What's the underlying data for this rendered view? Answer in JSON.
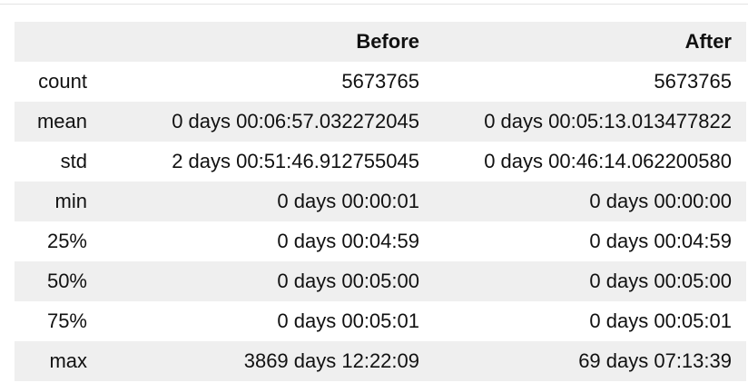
{
  "table": {
    "columns": [
      "Before",
      "After"
    ],
    "rows": [
      {
        "label": "count",
        "before": "5673765",
        "after": "5673765"
      },
      {
        "label": "mean",
        "before": "0 days 00:06:57.032272045",
        "after": "0 days 00:05:13.013477822"
      },
      {
        "label": "std",
        "before": "2 days 00:51:46.912755045",
        "after": "0 days 00:46:14.062200580"
      },
      {
        "label": "min",
        "before": "0 days 00:00:01",
        "after": "0 days 00:00:00"
      },
      {
        "label": "25%",
        "before": "0 days 00:04:59",
        "after": "0 days 00:04:59"
      },
      {
        "label": "50%",
        "before": "0 days 00:05:00",
        "after": "0 days 00:05:00"
      },
      {
        "label": "75%",
        "before": "0 days 00:05:01",
        "after": "0 days 00:05:01"
      },
      {
        "label": "max",
        "before": "3869 days 12:22:09",
        "after": "69 days 07:13:39"
      }
    ]
  },
  "colors": {
    "header_bg": "#efefef",
    "striped_row_bg": "#efefef",
    "text": "#111111"
  }
}
